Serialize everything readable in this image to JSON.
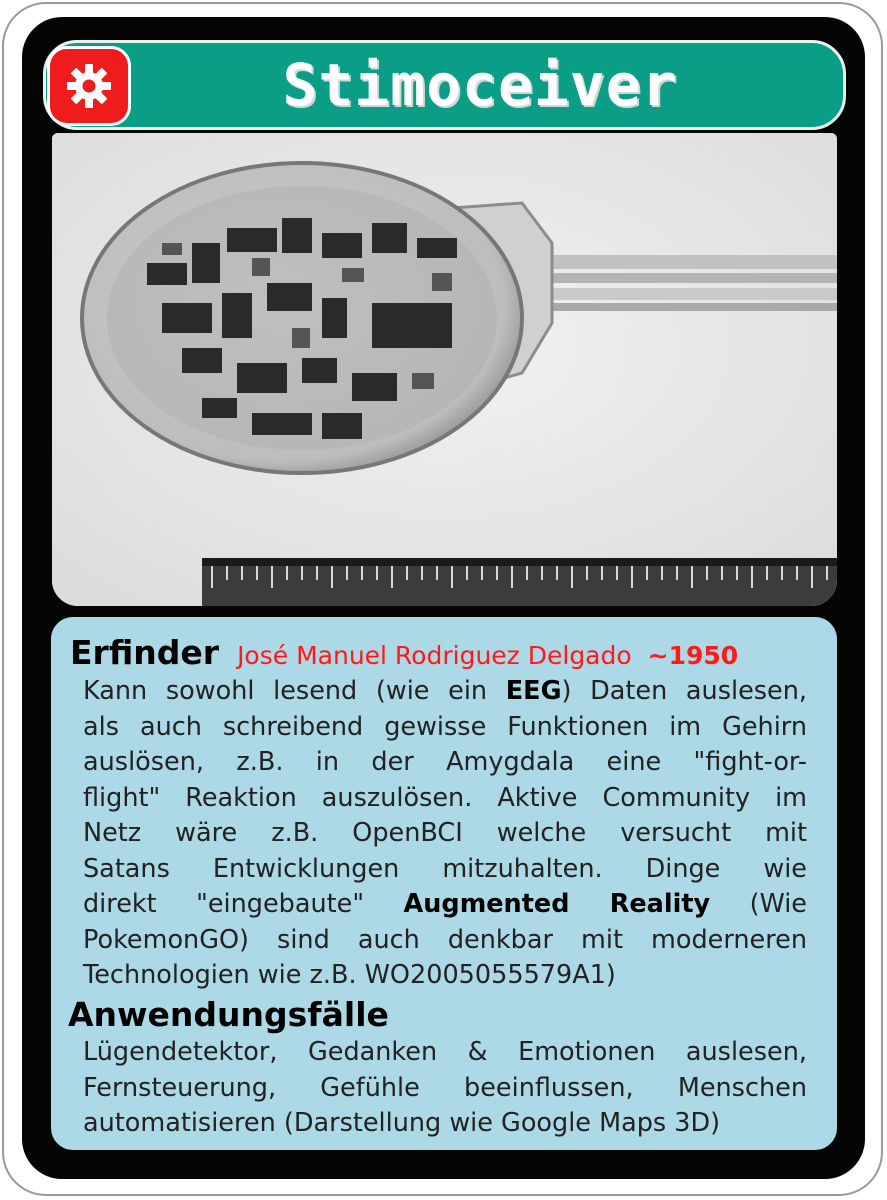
{
  "card": {
    "title": "Stimoceiver",
    "category_icon": "gear-icon",
    "colors": {
      "title_bar": "#0b9e86",
      "badge": "#ee1c1c",
      "panel": "#add8e6",
      "highlight": "#ff1a1a"
    }
  },
  "photo": {
    "description_icon": "stimoceiver-device-photo"
  },
  "inventor": {
    "label": "Erfinder",
    "name": "José Manuel Rodriguez Delgado",
    "year": "~1950"
  },
  "description": {
    "lines": [
      [
        "Kann sowohl lesend (wie ein ",
        "EEG",
        ") Daten auslesen,"
      ],
      [
        "als auch schreibend gewisse Funktionen im Gehirn"
      ],
      [
        "auslösen, z.B. in der Amygdala eine \"fight-or-"
      ],
      [
        "flight\" Reaktion auszulösen. Aktive Community im"
      ],
      [
        "Netz wäre z.B. OpenBCI welche versucht mit"
      ],
      [
        "Satans Entwicklungen mitzuhalten. Dinge wie"
      ],
      [
        "direkt \"eingebaute\" ",
        "Augmented Reality",
        " (Wie"
      ],
      [
        "PokemonGO) sind auch denkbar mit moderneren"
      ],
      [
        "Technologien wie z.B. WO2005055579A1)"
      ]
    ]
  },
  "use_cases": {
    "label": "Anwendungsfälle",
    "lines": [
      "Lügendetektor, Gedanken & Emotionen auslesen,",
      "Fernsteuerung, Gefühle beeinflussen, Menschen",
      "automatisieren (Darstellung wie Google Maps 3D)"
    ]
  }
}
